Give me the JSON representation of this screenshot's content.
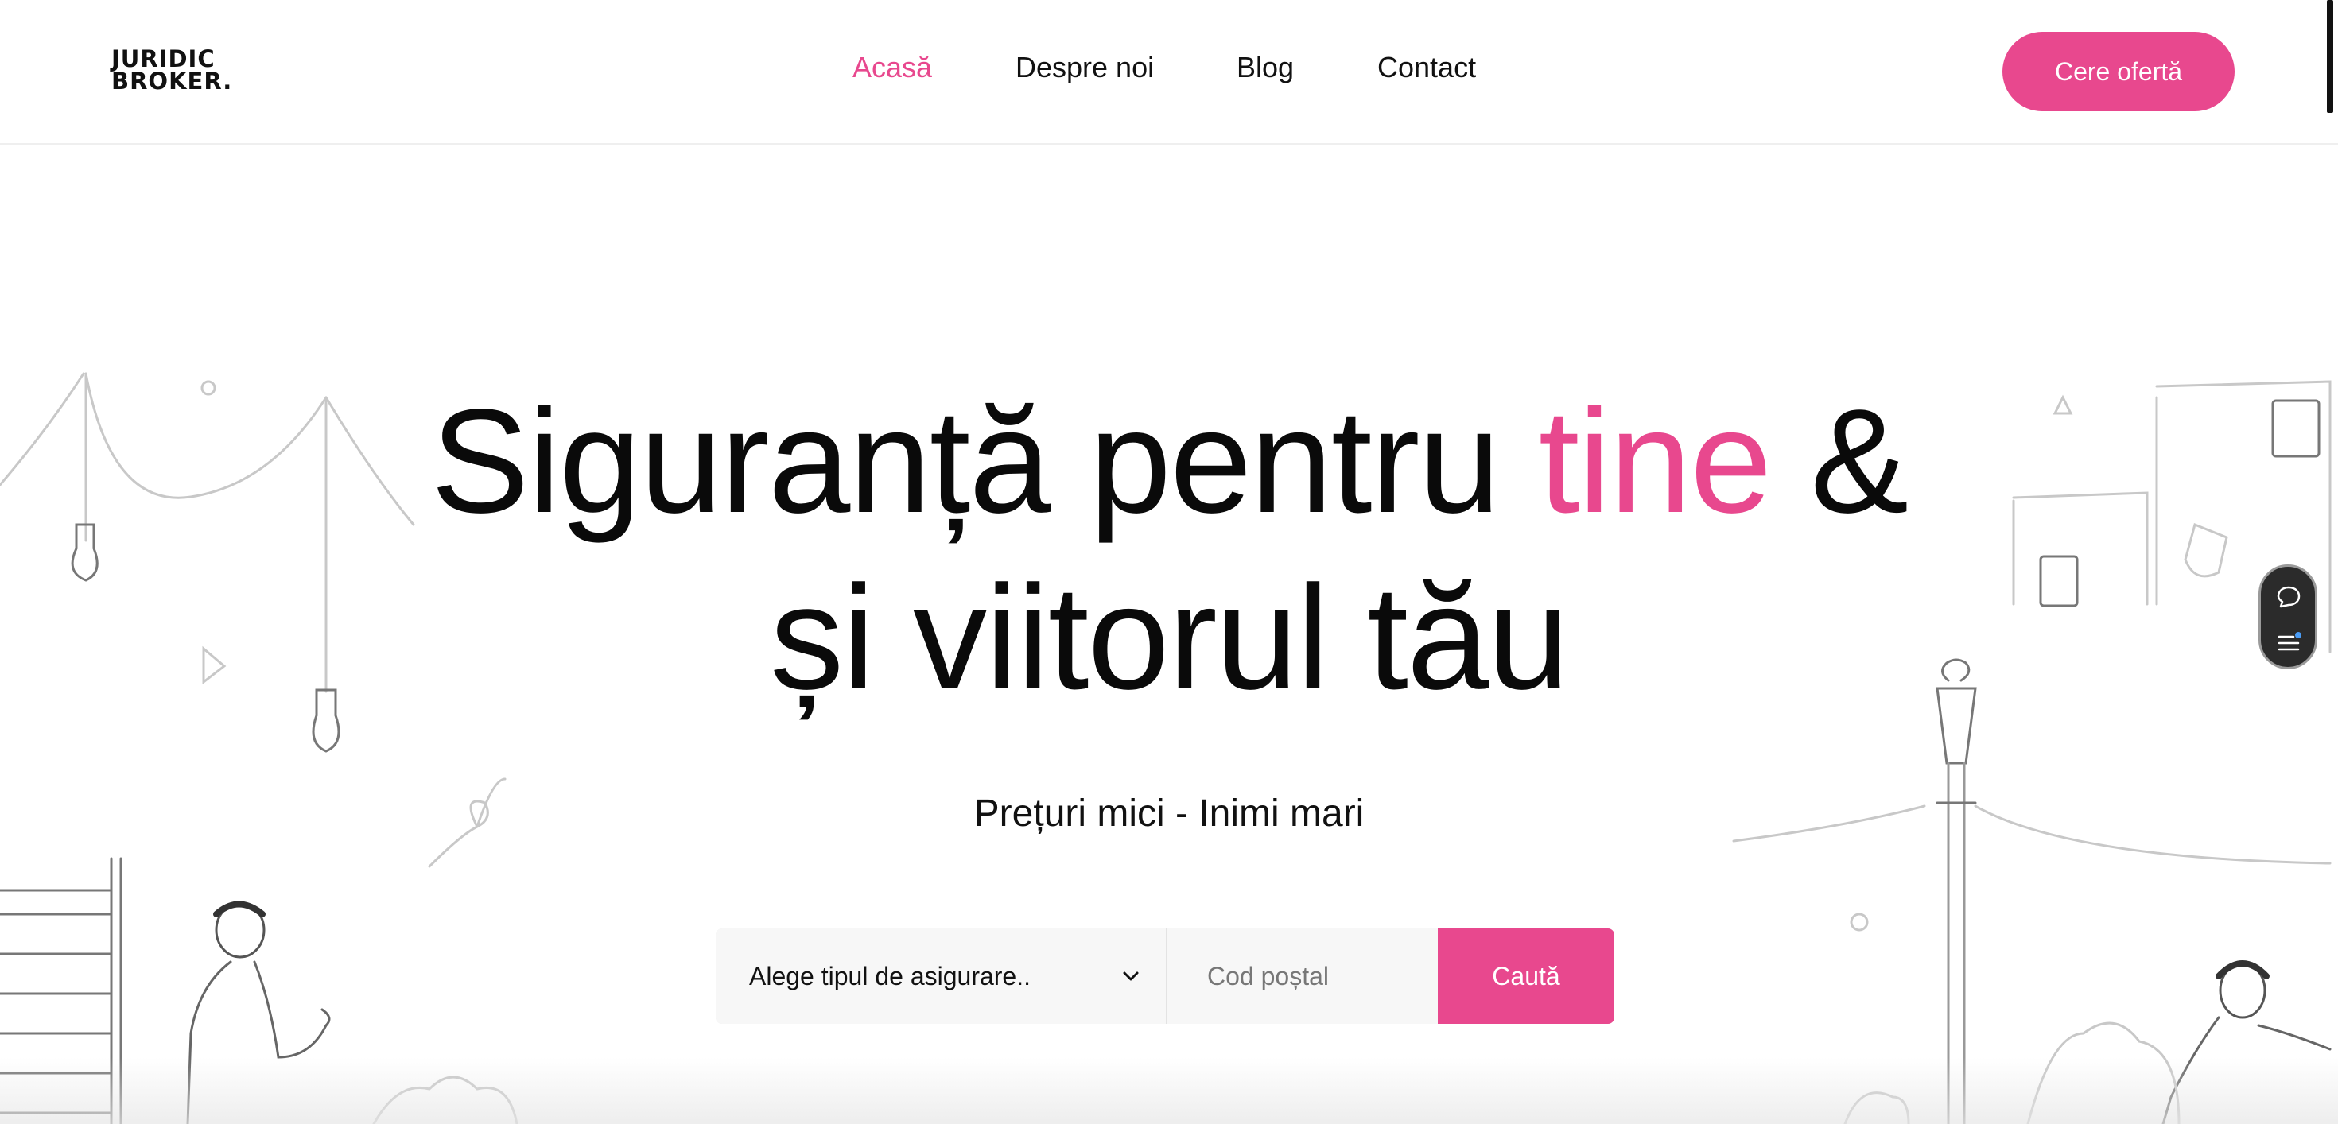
{
  "brand": {
    "logo_line1": "JURIDIC",
    "logo_line2": "BROKER."
  },
  "nav": [
    {
      "label": "Acasă",
      "active": true
    },
    {
      "label": "Despre noi",
      "active": false
    },
    {
      "label": "Blog",
      "active": false
    },
    {
      "label": "Contact",
      "active": false
    }
  ],
  "cta": {
    "label": "Cere ofertă"
  },
  "hero": {
    "title_part1": "Siguranță pentru ",
    "title_accent": "tine",
    "title_part2": " &",
    "title_line2": "și viitorul tău",
    "tagline": "Prețuri mici - Inimi mari"
  },
  "search": {
    "select_value": "Alege tipul de asigurare..",
    "zip_placeholder": "Cod poștal",
    "button_label": "Caută"
  },
  "colors": {
    "accent": "#e8488e",
    "text": "#111111",
    "field_bg": "#f7f7f7"
  },
  "icons": {
    "select_chevron": "chevron-down-icon",
    "widget_top": "chat-bubble-icon",
    "widget_bottom": "menu-notification-icon"
  }
}
